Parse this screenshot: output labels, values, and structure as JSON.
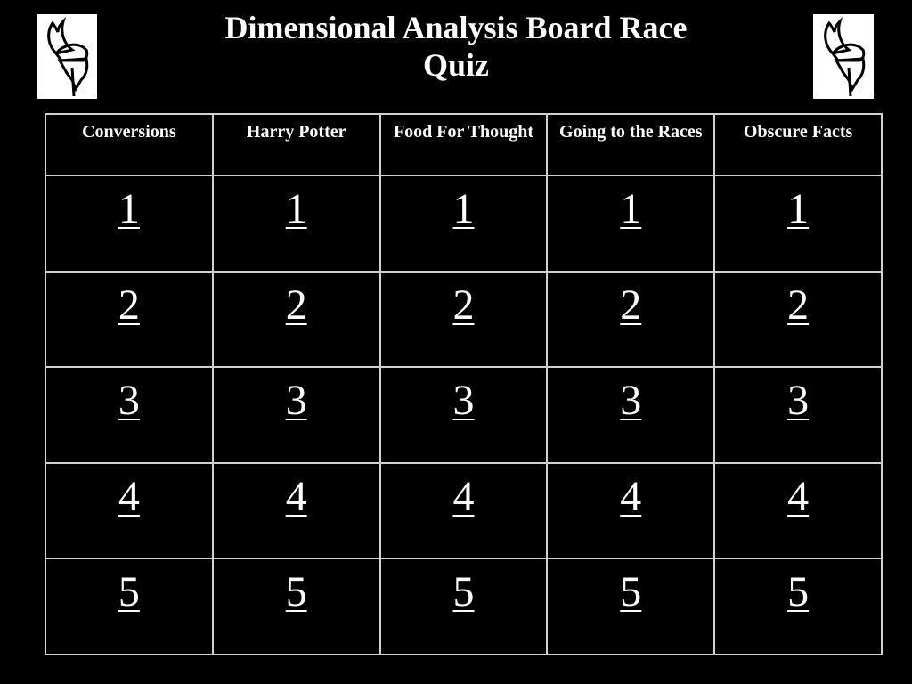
{
  "slide": {
    "title_line1": "Dimensional Analysis Board Race",
    "title_line2": "Quiz",
    "logos": [
      "viking-logo",
      "viking-logo"
    ]
  },
  "board": {
    "categories": [
      {
        "label": "Conversions"
      },
      {
        "label": "Harry Potter"
      },
      {
        "label": "Food For Thought"
      },
      {
        "label": "Going to the Races"
      },
      {
        "label": "Obscure Facts"
      }
    ],
    "rows": [
      [
        "1",
        "1",
        "1",
        "1",
        "1"
      ],
      [
        "2",
        "2",
        "2",
        "2",
        "2"
      ],
      [
        "3",
        "3",
        "3",
        "3",
        "3"
      ],
      [
        "4",
        "4",
        "4",
        "4",
        "4"
      ],
      [
        "5",
        "5",
        "5",
        "5",
        "5"
      ]
    ]
  }
}
